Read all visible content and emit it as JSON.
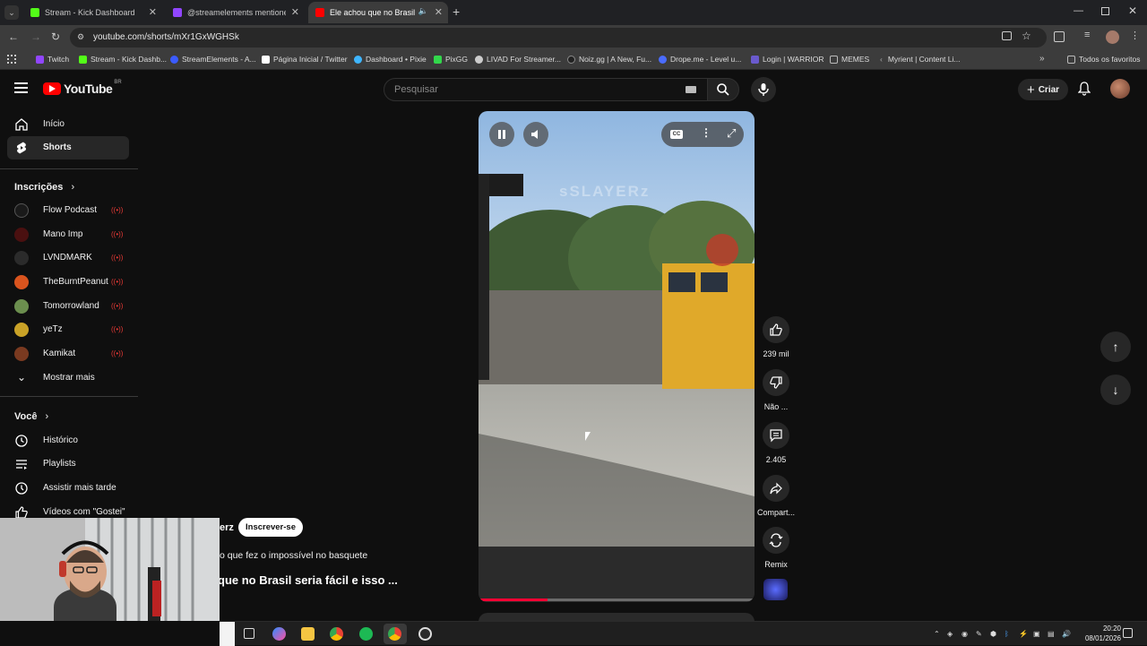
{
  "browser": {
    "tabs": [
      {
        "title": "Stream - Kick Dashboard",
        "favicon_color": "#53fc18"
      },
      {
        "title": "@streamelements mentione",
        "favicon_color": "#9146ff"
      },
      {
        "title": "Ele achou que no Brasil ser",
        "favicon_color": "#ff0000"
      }
    ],
    "new_tab": "+",
    "url": "youtube.com/shorts/mXr1GxWGHSk",
    "bookmarks": [
      {
        "label": "Twitch",
        "color": "#9146ff"
      },
      {
        "label": "Stream - Kick Dashb...",
        "color": "#53fc18"
      },
      {
        "label": "StreamElements - A...",
        "color": "#3b5bff"
      },
      {
        "label": "Página Inicial / Twitter",
        "color": "#ffffff"
      },
      {
        "label": "Dashboard • Pixie",
        "color": "#3fb6ff"
      },
      {
        "label": "PixGG",
        "color": "#32d74b"
      },
      {
        "label": "LIVAD For Streamer...",
        "color": "#cccccc"
      },
      {
        "label": "Noiz.gg | A New, Fu...",
        "color": "#222222"
      },
      {
        "label": "Drope.me - Level u...",
        "color": "#4a6cff"
      },
      {
        "label": "Login | WARRIOR",
        "color": "#6a5acd"
      },
      {
        "label": "MEMES",
        "color": "#bbbbbb"
      },
      {
        "label": "Myrient | Content Li...",
        "color": "#999999"
      }
    ],
    "all_bookmarks": "Todos os favoritos"
  },
  "youtube": {
    "logo_text": "YouTube",
    "region": "BR",
    "search_placeholder": "Pesquisar",
    "create_label": "Criar"
  },
  "sidebar": {
    "main": [
      {
        "label": "Início",
        "icon": "home-icon"
      },
      {
        "label": "Shorts",
        "icon": "shorts-icon"
      }
    ],
    "subs_header": "Inscrições",
    "subscriptions": [
      {
        "name": "Flow Podcast",
        "color": "#1a1a1a"
      },
      {
        "name": "Mano Imp",
        "color": "#4a1010"
      },
      {
        "name": "LVNDMARK",
        "color": "#2b2b2b"
      },
      {
        "name": "TheBurntPeanut",
        "color": "#d9541e"
      },
      {
        "name": "Tomorrowland",
        "color": "#6b8e4e"
      },
      {
        "name": "yeTz",
        "color": "#c9a227"
      },
      {
        "name": "Kamikat",
        "color": "#7a3a20"
      }
    ],
    "show_more": "Mostrar mais",
    "you_header": "Você",
    "you_items": [
      {
        "label": "Histórico",
        "icon": "history-icon"
      },
      {
        "label": "Playlists",
        "icon": "playlists-icon"
      },
      {
        "label": "Assistir mais tarde",
        "icon": "watch-later-icon"
      },
      {
        "label": "Vídeos com \"Gostei\"",
        "icon": "like-icon"
      }
    ]
  },
  "video": {
    "watermark": "sSLAYERz",
    "channel_suffix": "erz",
    "subscribe_label": "Inscrever-se",
    "description": "o que fez o impossível no basquete",
    "title": "que no Brasil seria fácil e isso ...",
    "progress_percent": 25
  },
  "actions": {
    "likes": "239 mil",
    "dislike": "Não ...",
    "comments": "2.405",
    "share": "Compart...",
    "remix": "Remix"
  },
  "taskbar": {
    "time": "20:20",
    "date": "08/01/2026"
  }
}
